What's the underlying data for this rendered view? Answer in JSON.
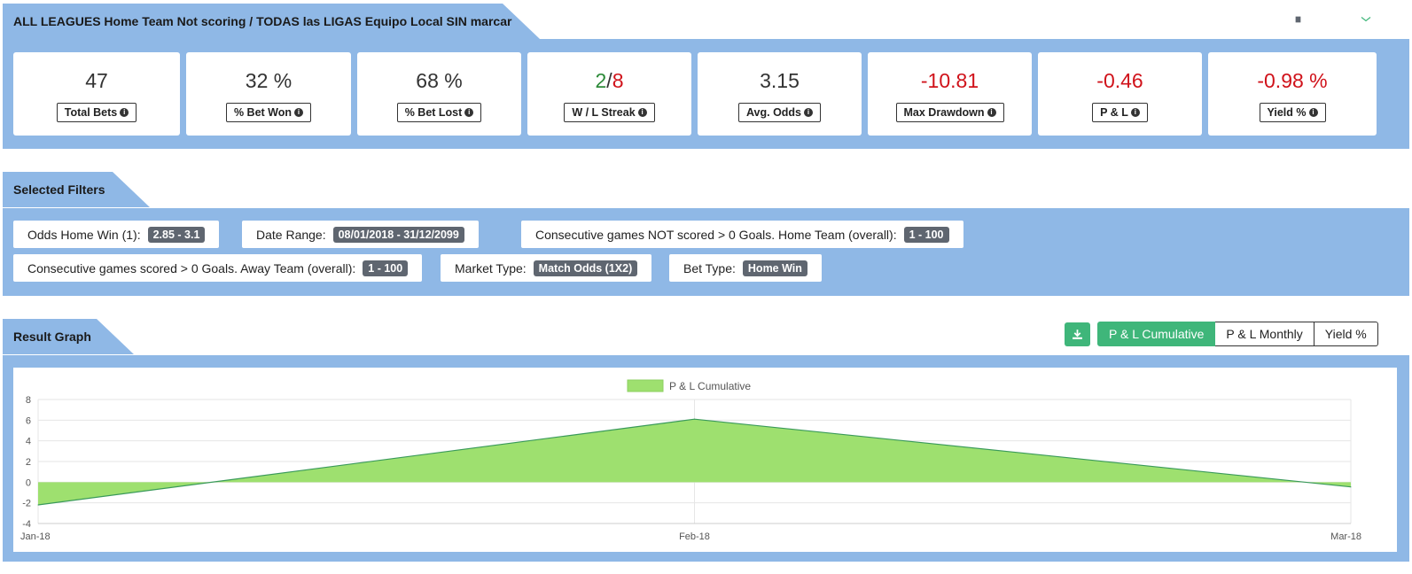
{
  "header": {
    "title": "ALL LEAGUES Home Team Not scoring / TODAS las LIGAS Equipo Local SIN marcar"
  },
  "toolbar": {
    "buttons": [
      {
        "icon": "copy-icon",
        "color": "#5f6670"
      },
      {
        "icon": "download-icon",
        "color": "#3fb67a"
      },
      {
        "icon": "share-icon",
        "color": "#f0a33a"
      },
      {
        "icon": "envelope-icon",
        "color": "#3fb67a"
      }
    ]
  },
  "stats": [
    {
      "value": "47",
      "label": "Total Bets"
    },
    {
      "value": "32 %",
      "label": "% Bet Won"
    },
    {
      "value": "68 %",
      "label": "% Bet Lost"
    },
    {
      "value_win": "2",
      "value_sep": "/",
      "value_loss": "8",
      "label": "W / L Streak"
    },
    {
      "value": "3.15",
      "label": "Avg. Odds"
    },
    {
      "value": "-10.81",
      "label": "Max Drawdown"
    },
    {
      "value": "-0.46",
      "label": "P & L"
    },
    {
      "value": "-0.98 %",
      "label": "Yield %"
    }
  ],
  "filters": {
    "title": "Selected Filters",
    "items": [
      {
        "label": "Odds Home Win (1):",
        "value": "2.85 - 3.1"
      },
      {
        "label": "Date Range:",
        "value": "08/01/2018 - 31/12/2099"
      },
      {
        "label": "Consecutive games NOT scored > 0 Goals. Home Team (overall):",
        "value": "1 - 100"
      },
      {
        "label": "Consecutive games scored > 0 Goals. Away Team (overall):",
        "value": "1 - 100"
      },
      {
        "label": "Market Type:",
        "value": "Match Odds (1X2)"
      },
      {
        "label": "Bet Type:",
        "value": "Home Win"
      }
    ]
  },
  "graph": {
    "title": "Result Graph",
    "tabs": [
      "P & L Cumulative",
      "P & L Monthly",
      "Yield %"
    ],
    "active_tab": "P & L Cumulative"
  },
  "chart_data": {
    "type": "area",
    "categories": [
      "Jan-18",
      "Feb-18",
      "Mar-18"
    ],
    "series": [
      {
        "name": "P & L Cumulative",
        "values": [
          -2.2,
          6.1,
          -0.46
        ],
        "color": "#9ee06f"
      }
    ],
    "yticks": [
      8,
      6,
      4,
      2,
      0,
      -2,
      -4
    ],
    "ylim": [
      -4,
      8
    ],
    "legend": "top-center",
    "grid": true
  }
}
